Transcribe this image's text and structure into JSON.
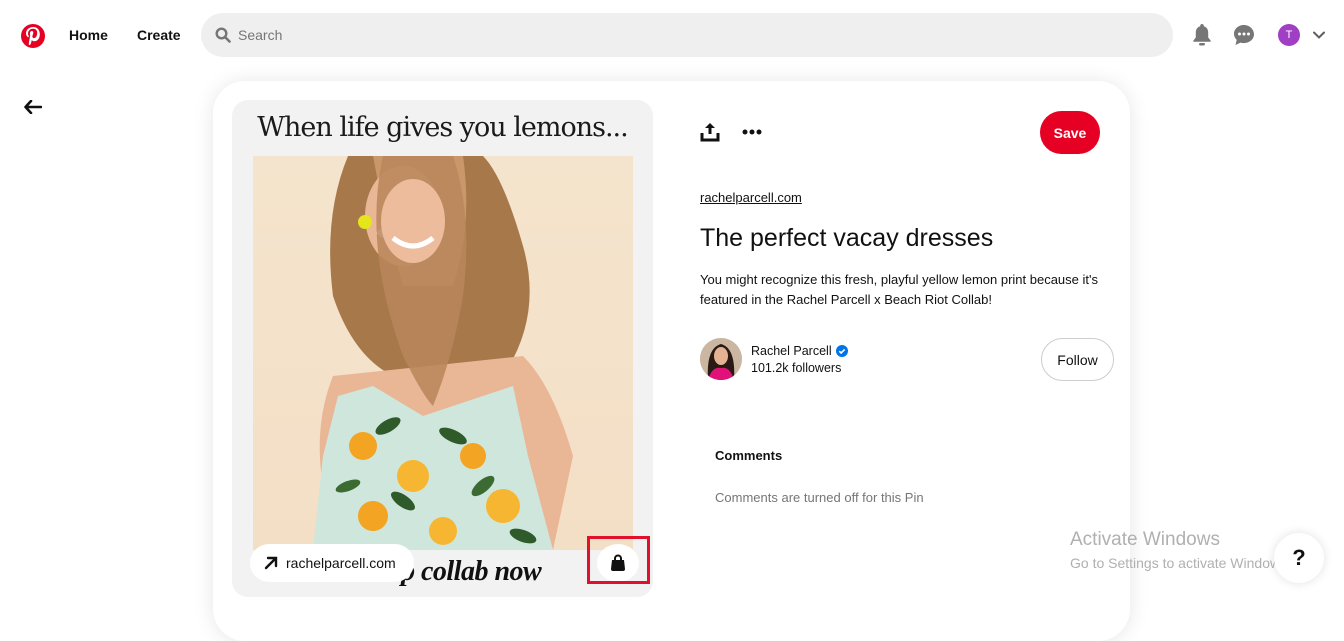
{
  "nav": {
    "home_label": "Home",
    "create_label": "Create",
    "search_placeholder": "Search",
    "user_initial": "T",
    "brand_color": "#e60023",
    "avatar_color": "#a03ec4"
  },
  "pin": {
    "image_headline": "When life gives you lemons...",
    "image_footer_text": "shop collab now",
    "link_pill_label": "rachelparcell.com",
    "save_label": "Save",
    "source_link": "rachelparcell.com",
    "title": "The perfect vacay dresses",
    "description": "You might recognize this fresh, playful yellow lemon print because it's featured in the Rachel Parcell x Beach Riot Collab!",
    "creator": {
      "name": "Rachel Parcell",
      "verified": true,
      "followers": "101.2k followers",
      "follow_label": "Follow"
    },
    "comments": {
      "heading": "Comments",
      "status": "Comments are turned off for this Pin"
    }
  },
  "overlay": {
    "activate_title": "Activate Windows",
    "activate_subtitle": "Go to Settings to activate Windows.",
    "help_label": "?"
  }
}
